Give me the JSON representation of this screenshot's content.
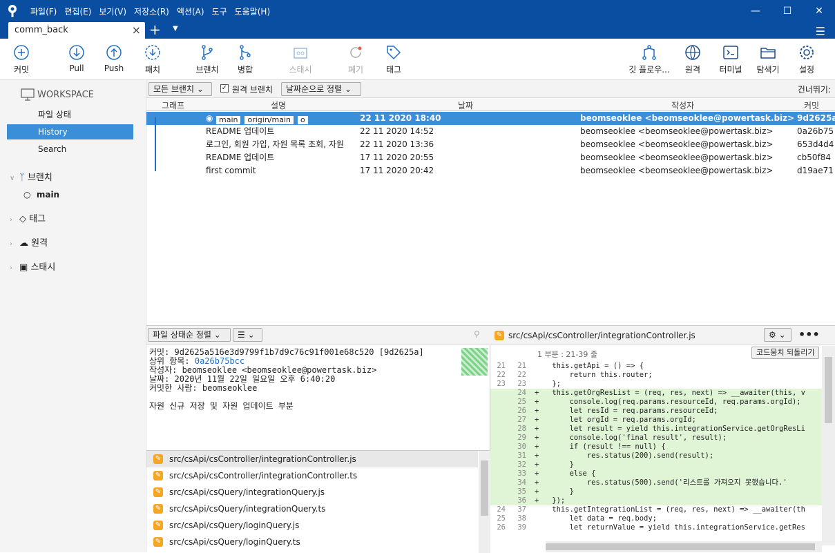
{
  "window": {
    "menu": [
      "파일(F)",
      "편집(E)",
      "보기(V)",
      "저장소(R)",
      "액션(A)",
      "도구",
      "도움말(H)"
    ]
  },
  "tab": {
    "title": "comm_back"
  },
  "toolbar": {
    "commit": "커밋",
    "pull": "Pull",
    "push": "Push",
    "patch": "패치",
    "branch": "브랜치",
    "merge": "병합",
    "stash": "스태시",
    "discard": "폐기",
    "tag": "태그",
    "gitflow": "깃 플로우...",
    "remote": "원격",
    "terminal": "터미널",
    "explorer": "탐색기",
    "settings": "설정"
  },
  "sidebar": {
    "workspace": "WORKSPACE",
    "file_status": "파일 상태",
    "history": "History",
    "search": "Search",
    "branches": "브랜치",
    "branch_main": "main",
    "tags": "태그",
    "remotes": "원격",
    "stashes": "스태시"
  },
  "filter": {
    "all_branches": "모든 브랜치",
    "remote_branches": "원격 브랜치",
    "sort": "날짜순으로 정렬",
    "skip": "건너뛰기:"
  },
  "columns": {
    "graph": "그래프",
    "desc": "설명",
    "date": "날짜",
    "author": "작성자",
    "commit": "커밋"
  },
  "commits": [
    {
      "labels": [
        "main",
        "origin/main",
        "o"
      ],
      "desc": "",
      "date": "22 11 2020 18:40",
      "author": "beomseoklee <beomseoklee@powertask.biz>",
      "hash": "9d2625a"
    },
    {
      "labels": [],
      "desc": "README 업데이트",
      "date": "22 11 2020 14:52",
      "author": "beomseoklee <beomseoklee@powertask.biz>",
      "hash": "0a26b75"
    },
    {
      "labels": [],
      "desc": "로그인, 회원 가입, 자원 목록 조회, 자원",
      "date": "22 11 2020 13:36",
      "author": "beomseoklee <beomseoklee@powertask.biz>",
      "hash": "653d4d4"
    },
    {
      "labels": [],
      "desc": "README 업데이트",
      "date": "17 11 2020 20:55",
      "author": "beomseoklee <beomseoklee@powertask.biz>",
      "hash": "cb50f84"
    },
    {
      "labels": [],
      "desc": "first commit",
      "date": "17 11 2020 20:42",
      "author": "beomseoklee <beomseoklee@powertask.biz>",
      "hash": "d19ae71"
    }
  ],
  "details": {
    "sort": "파일 상태순 정렬",
    "commit": "커밋: 9d2625a516e3d9799f1b7d9c76c91f001e68c520 [9d2625a]",
    "parent_label": "상위 항목:",
    "parent": "0a26b75bcc",
    "author": "작성자: beomseoklee <beomseoklee@powertask.biz>",
    "date": "날짜: 2020년 11월 22일 일요일 오후 6:40:20",
    "committer": "커밋한 사람: beomseoklee",
    "message": "자원 신규 저장 및 자원 업데이트 부분"
  },
  "files": [
    "src/csApi/csController/integrationController.js",
    "src/csApi/csController/integrationController.ts",
    "src/csApi/csQuery/integrationQuery.js",
    "src/csApi/csQuery/integrationQuery.ts",
    "src/csApi/csQuery/loginQuery.js",
    "src/csApi/csQuery/loginQuery.ts"
  ],
  "diff": {
    "file": "src/csApi/csController/integrationController.js",
    "hunk": "1 부분 : 21-39 줄",
    "revert": "코드뭉치 되돌리기",
    "lines": [
      {
        "o": "21",
        "n": "21",
        "t": "ctx",
        "c": "    this.getApi = () => {"
      },
      {
        "o": "22",
        "n": "22",
        "t": "ctx",
        "c": "        return this.router;"
      },
      {
        "o": "23",
        "n": "23",
        "t": "ctx",
        "c": "    };"
      },
      {
        "o": "",
        "n": "24",
        "t": "add",
        "c": "+   this.getOrgResList = (req, res, next) => __awaiter(this, v"
      },
      {
        "o": "",
        "n": "25",
        "t": "add",
        "c": "+       console.log(req.params.resourceId, req.params.orgId);"
      },
      {
        "o": "",
        "n": "26",
        "t": "add",
        "c": "+       let resId = req.params.resourceId;"
      },
      {
        "o": "",
        "n": "27",
        "t": "add",
        "c": "+       let orgId = req.params.orgId;"
      },
      {
        "o": "",
        "n": "28",
        "t": "add",
        "c": "+       let result = yield this.integrationService.getOrgResLi"
      },
      {
        "o": "",
        "n": "29",
        "t": "add",
        "c": "+       console.log('final result', result);"
      },
      {
        "o": "",
        "n": "30",
        "t": "add",
        "c": "+       if (result !== null) {"
      },
      {
        "o": "",
        "n": "31",
        "t": "add",
        "c": "+           res.status(200).send(result);"
      },
      {
        "o": "",
        "n": "32",
        "t": "add",
        "c": "+       }"
      },
      {
        "o": "",
        "n": "33",
        "t": "add",
        "c": "+       else {"
      },
      {
        "o": "",
        "n": "34",
        "t": "add",
        "c": "+           res.status(500).send('리스트를 가져오지 못했습니다.'"
      },
      {
        "o": "",
        "n": "35",
        "t": "add",
        "c": "+       }"
      },
      {
        "o": "",
        "n": "36",
        "t": "add",
        "c": "+   });"
      },
      {
        "o": "24",
        "n": "37",
        "t": "ctx",
        "c": "    this.getIntegrationList = (req, res, next) => __awaiter(th"
      },
      {
        "o": "25",
        "n": "38",
        "t": "ctx",
        "c": "        let data = req.body;"
      },
      {
        "o": "26",
        "n": "39",
        "t": "ctx",
        "c": "        let returnValue = yield this.integrationService.getRes"
      }
    ]
  }
}
